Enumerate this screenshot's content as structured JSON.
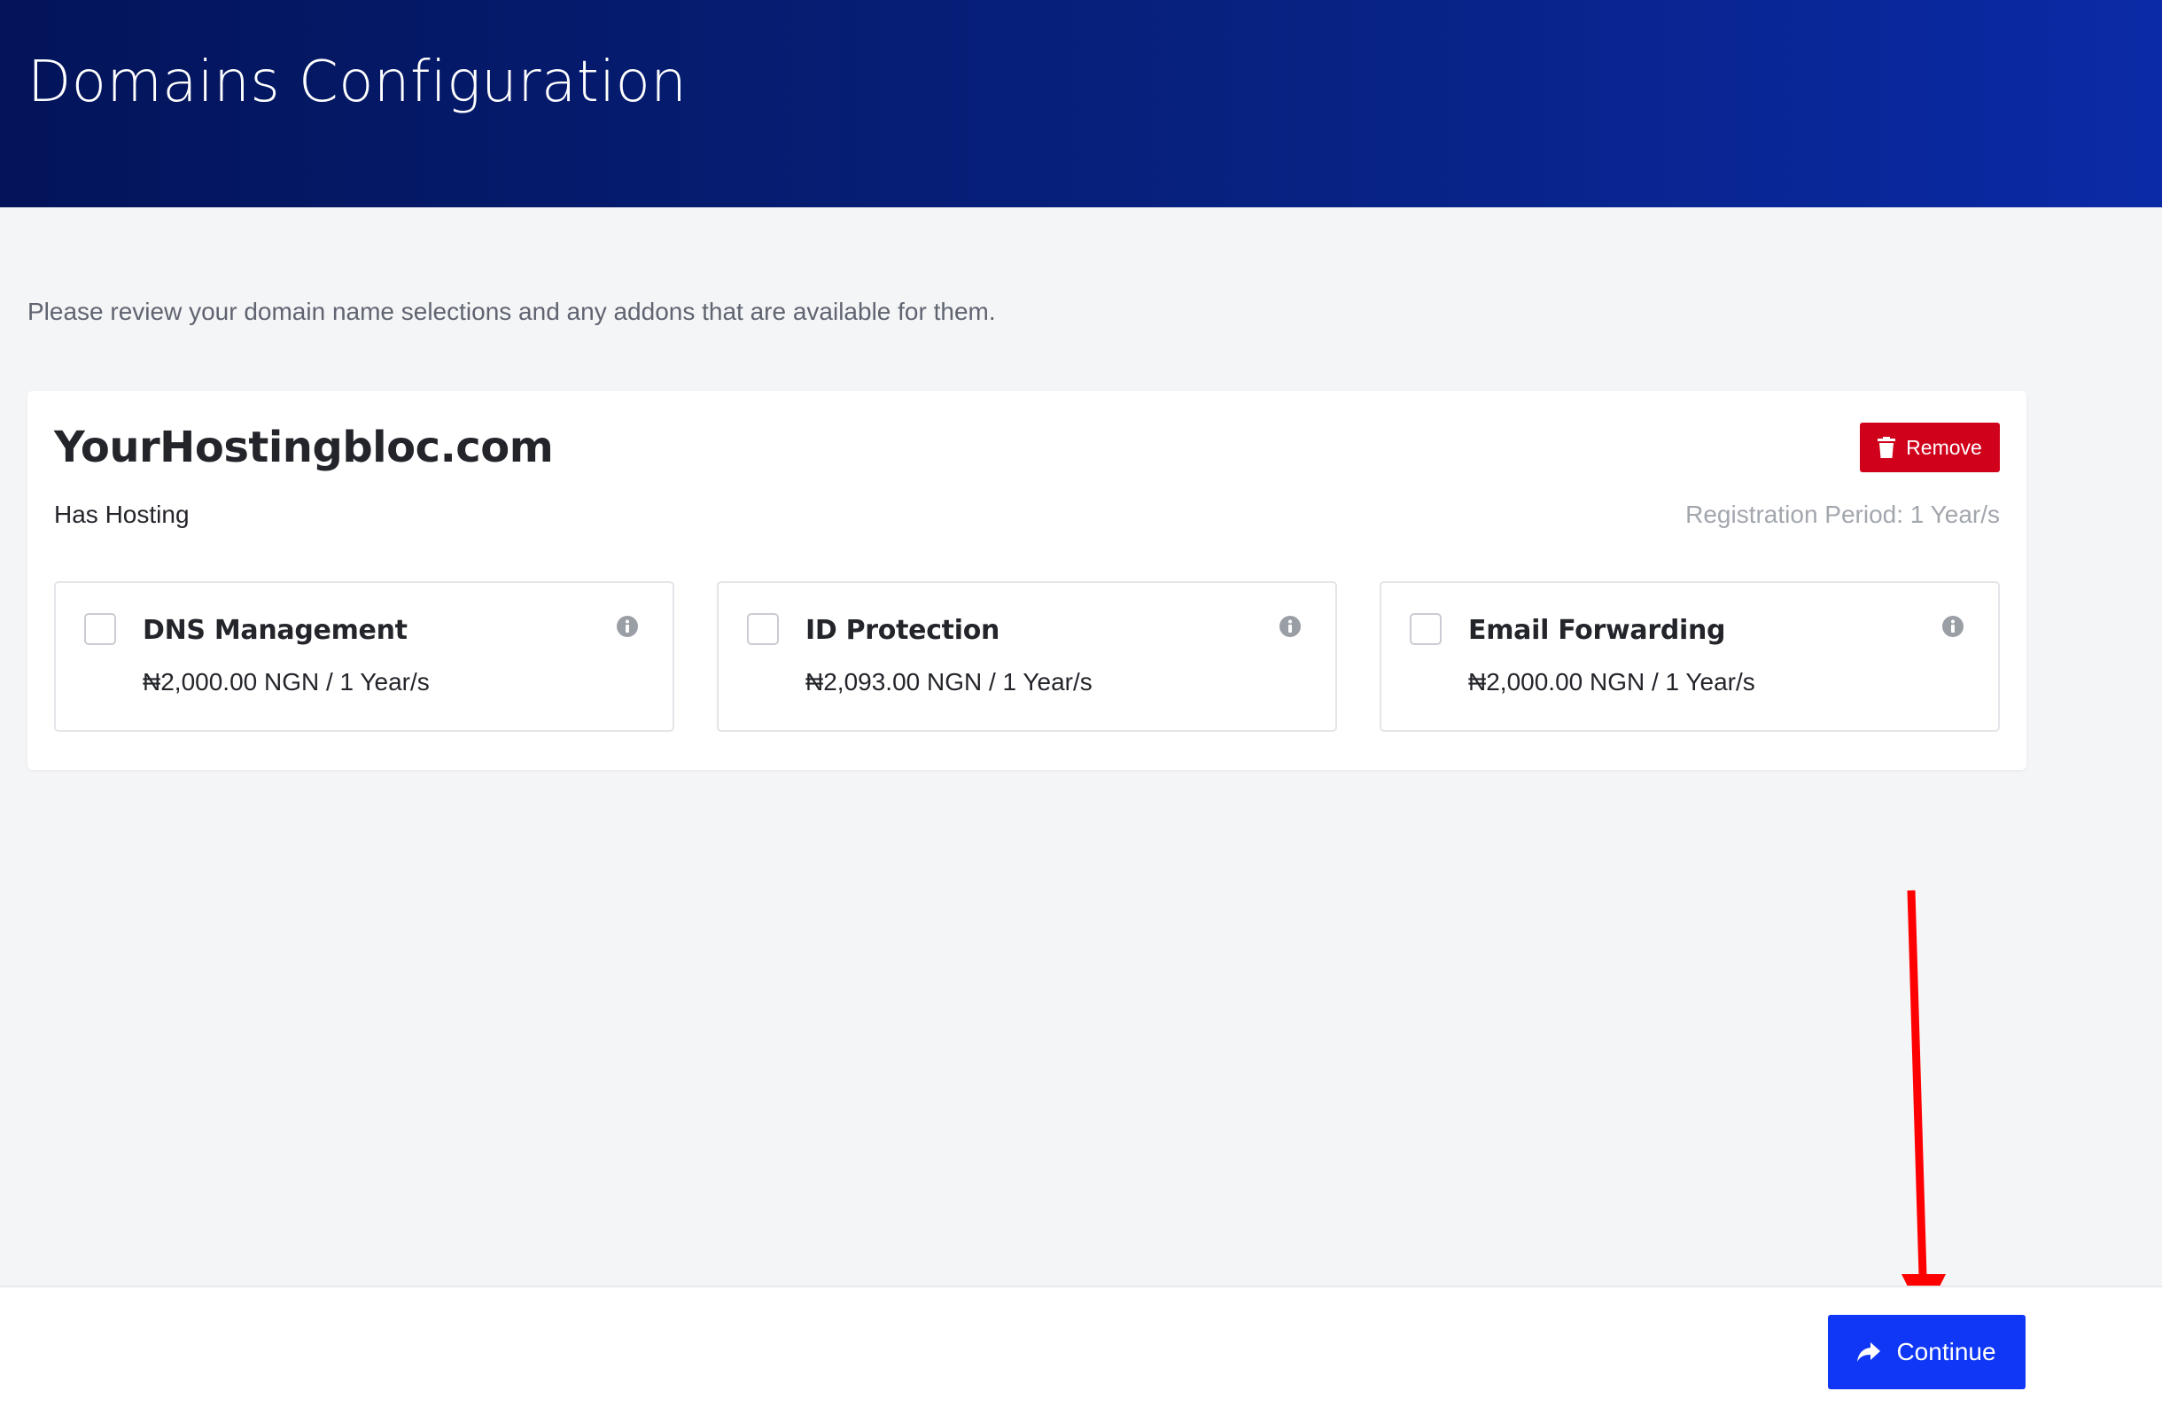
{
  "header": {
    "title": "Domains Configuration"
  },
  "intro_text": "Please review your domain name selections and any addons that are available for them.",
  "domain": {
    "name": "YourHostingbloc.com",
    "hosting_status": "Has Hosting",
    "remove_label": "Remove",
    "registration_period": "Registration Period: 1 Year/s"
  },
  "addons": [
    {
      "name": "DNS Management",
      "price": "₦2,000.00 NGN / 1 Year/s",
      "checked": false
    },
    {
      "name": "ID Protection",
      "price": "₦2,093.00 NGN / 1 Year/s",
      "checked": false
    },
    {
      "name": "Email Forwarding",
      "price": "₦2,000.00 NGN / 1 Year/s",
      "checked": false
    }
  ],
  "footer": {
    "continue_label": "Continue"
  },
  "colors": {
    "header_bg": "#03145a",
    "remove_bg": "#d0021b",
    "continue_bg": "#1037f5",
    "annotation_arrow": "#ff0000"
  },
  "icons": {
    "remove": "trash-icon",
    "info": "info-circle-icon",
    "continue": "share-arrow-icon"
  }
}
